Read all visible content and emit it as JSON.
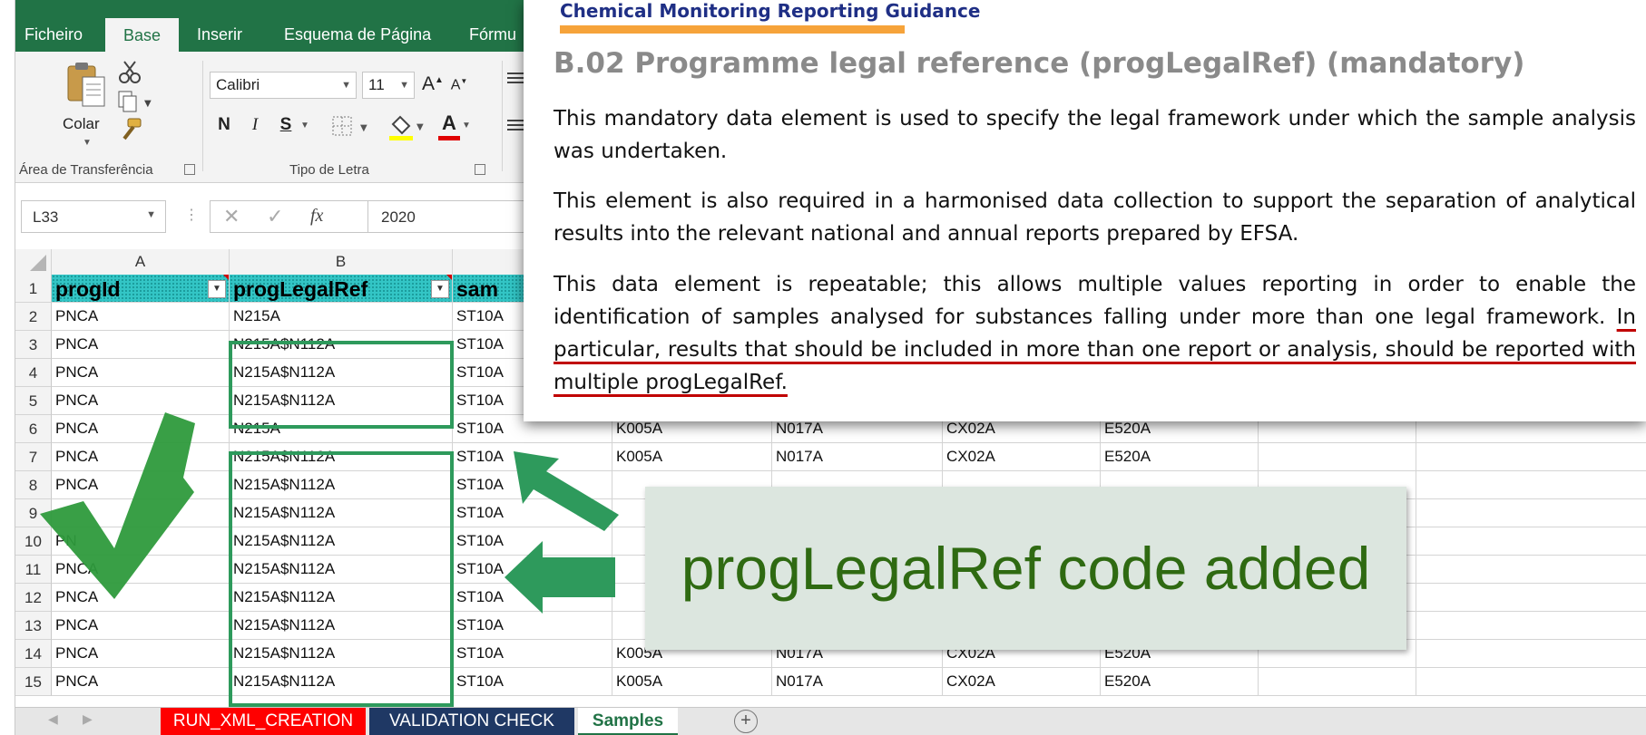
{
  "ribbon": {
    "tabs": [
      "Ficheiro",
      "Base",
      "Inserir",
      "Esquema de Página",
      "Fórmu"
    ],
    "active_tab": "Base",
    "clipboard": {
      "paste_label": "Colar",
      "group_label": "Área de Transferência"
    },
    "font": {
      "name": "Calibri",
      "size": "11",
      "group_label": "Tipo de Letra",
      "bold": "N",
      "italic": "I",
      "underline": "S",
      "grow": "A",
      "shrink": "A",
      "font_color": "A"
    }
  },
  "formula_bar": {
    "name_box": "L33",
    "value": "2020",
    "fx": "fx"
  },
  "grid": {
    "columns": [
      "A",
      "B"
    ],
    "headers": [
      "progId",
      "progLegalRef",
      "sam"
    ],
    "row_numbers": [
      "1",
      "2",
      "3",
      "4",
      "5",
      "6",
      "7",
      "8",
      "9",
      "10",
      "11",
      "12",
      "13",
      "14",
      "15"
    ],
    "rows": [
      [
        "PNCA",
        "N215A",
        "ST10A",
        "",
        "",
        "",
        ""
      ],
      [
        "PNCA",
        "N215A$N112A",
        "ST10A",
        "",
        "",
        "",
        ""
      ],
      [
        "PNCA",
        "N215A$N112A",
        "ST10A",
        "",
        "",
        "",
        ""
      ],
      [
        "PNCA",
        "N215A$N112A",
        "ST10A",
        "",
        "",
        "",
        ""
      ],
      [
        "PNCA",
        "N215A",
        "ST10A",
        "K005A",
        "N017A",
        "CX02A",
        "E520A"
      ],
      [
        "PNCA",
        "N215A$N112A",
        "ST10A",
        "K005A",
        "N017A",
        "CX02A",
        "E520A"
      ],
      [
        "PNCA",
        "N215A$N112A",
        "ST10A",
        "",
        "",
        "",
        ""
      ],
      [
        "",
        "N215A$N112A",
        "ST10A",
        "",
        "",
        "",
        ""
      ],
      [
        "PN",
        "N215A$N112A",
        "ST10A",
        "",
        "",
        "",
        ""
      ],
      [
        "PNCA",
        "N215A$N112A",
        "ST10A",
        "",
        "",
        "",
        ""
      ],
      [
        "PNCA",
        "N215A$N112A",
        "ST10A",
        "",
        "",
        "",
        ""
      ],
      [
        "PNCA",
        "N215A$N112A",
        "ST10A",
        "",
        "",
        "",
        ""
      ],
      [
        "PNCA",
        "N215A$N112A",
        "ST10A",
        "K005A",
        "N017A",
        "CX02A",
        "E520A"
      ],
      [
        "PNCA",
        "N215A$N112A",
        "ST10A",
        "K005A",
        "N017A",
        "CX02A",
        "E520A"
      ]
    ]
  },
  "sheet_tabs": [
    {
      "label": "RUN_XML_CREATION",
      "color": "#ff0000"
    },
    {
      "label": "VALIDATION CHECK",
      "color": "#1f3864"
    },
    {
      "label": "Samples",
      "color": "#ffffff"
    }
  ],
  "guidance": {
    "header": "Chemical Monitoring Reporting Guidance",
    "heading": "B.02 Programme legal reference (progLegalRef) (mandatory)",
    "p1": "This mandatory data element is used to specify the legal framework under which the sample analysis was undertaken.",
    "p2": "This element is also required in a harmonised data collection to support the separation of analytical results into the relevant national and annual reports prepared by EFSA.",
    "p3_plain": "This data element is repeatable; this allows multiple values reporting in order to enable the identification of samples analysed for substances falling under more than one legal framework.",
    "p3_underlined": "In particular, results that should be included in more than one report or analysis, should be reported with multiple progLegalRef."
  },
  "callout": {
    "text": "progLegalRef code added"
  },
  "colors": {
    "excel_green": "#217346",
    "box_green": "#2e9a5c",
    "check_green": "#2e9a3c",
    "callout_text": "#2f6a12",
    "underline_red": "#c00000"
  }
}
